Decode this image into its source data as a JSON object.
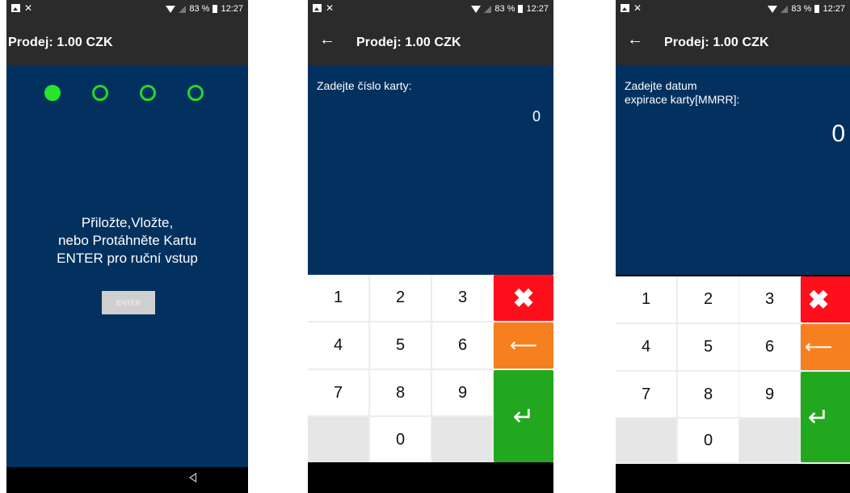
{
  "status": {
    "battery_text": "83 %",
    "time": "12:27"
  },
  "screen1": {
    "title": "Prodej: 1.00 CZK",
    "message_line1": "Přiložte,Vložte,",
    "message_line2": "nebo Protáhněte Kartu",
    "message_line3": "ENTER pro ruční vstup",
    "enter_label": "ENTER"
  },
  "screen2": {
    "title": "Prodej: 1.00 CZK",
    "prompt": "Zadejte číslo karty:",
    "value": "0"
  },
  "screen3": {
    "title": "Prodej: 1.00 CZK",
    "prompt_line1": "Zadejte datum",
    "prompt_line2": "expirace karty[MMRR]:",
    "value": "0"
  },
  "keypad": {
    "k1": "1",
    "k2": "2",
    "k3": "3",
    "k4": "4",
    "k5": "5",
    "k6": "6",
    "k7": "7",
    "k8": "8",
    "k9": "9",
    "k0": "0",
    "cancel_glyph": "✖",
    "backspace_glyph": "⟵",
    "enter_glyph": "↵"
  },
  "colors": {
    "background": "#02315f",
    "bar": "#2b2b2b",
    "progress": "#25e62a",
    "cancel": "#ff0f1b",
    "backspace": "#f6801f",
    "enter": "#21a81e"
  }
}
